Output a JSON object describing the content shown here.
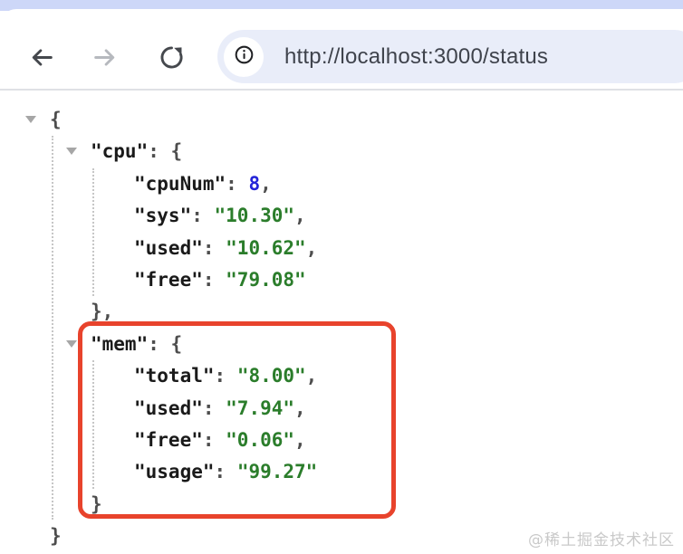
{
  "browser": {
    "url": "http://localhost:3000/status",
    "icons": {
      "back": "arrow-left-icon",
      "forward": "arrow-right-icon",
      "reload": "reload-icon",
      "site_info": "info-icon"
    }
  },
  "json_viewer": {
    "lines": [
      {
        "indent": 0,
        "toggle": true,
        "segments": [
          {
            "t": "{",
            "y": "punct"
          }
        ]
      },
      {
        "indent": 1,
        "toggle": true,
        "segments": [
          {
            "t": "\"cpu\"",
            "y": "key"
          },
          {
            "t": ": {",
            "y": "punct"
          }
        ]
      },
      {
        "indent": 2,
        "toggle": false,
        "segments": [
          {
            "t": "\"cpuNum\"",
            "y": "key"
          },
          {
            "t": ": ",
            "y": "punct"
          },
          {
            "t": "8",
            "y": "num"
          },
          {
            "t": ",",
            "y": "punct"
          }
        ]
      },
      {
        "indent": 2,
        "toggle": false,
        "segments": [
          {
            "t": "\"sys\"",
            "y": "key"
          },
          {
            "t": ": ",
            "y": "punct"
          },
          {
            "t": "\"10.30\"",
            "y": "str"
          },
          {
            "t": ",",
            "y": "punct"
          }
        ]
      },
      {
        "indent": 2,
        "toggle": false,
        "segments": [
          {
            "t": "\"used\"",
            "y": "key"
          },
          {
            "t": ": ",
            "y": "punct"
          },
          {
            "t": "\"10.62\"",
            "y": "str"
          },
          {
            "t": ",",
            "y": "punct"
          }
        ]
      },
      {
        "indent": 2,
        "toggle": false,
        "segments": [
          {
            "t": "\"free\"",
            "y": "key"
          },
          {
            "t": ": ",
            "y": "punct"
          },
          {
            "t": "\"79.08\"",
            "y": "str"
          }
        ]
      },
      {
        "indent": 1,
        "toggle": false,
        "segments": [
          {
            "t": "},",
            "y": "punct"
          }
        ]
      },
      {
        "indent": 1,
        "toggle": true,
        "segments": [
          {
            "t": "\"mem\"",
            "y": "key"
          },
          {
            "t": ": {",
            "y": "punct"
          }
        ]
      },
      {
        "indent": 2,
        "toggle": false,
        "segments": [
          {
            "t": "\"total\"",
            "y": "key"
          },
          {
            "t": ": ",
            "y": "punct"
          },
          {
            "t": "\"8.00\"",
            "y": "str"
          },
          {
            "t": ",",
            "y": "punct"
          }
        ]
      },
      {
        "indent": 2,
        "toggle": false,
        "segments": [
          {
            "t": "\"used\"",
            "y": "key"
          },
          {
            "t": ": ",
            "y": "punct"
          },
          {
            "t": "\"7.94\"",
            "y": "str"
          },
          {
            "t": ",",
            "y": "punct"
          }
        ]
      },
      {
        "indent": 2,
        "toggle": false,
        "segments": [
          {
            "t": "\"free\"",
            "y": "key"
          },
          {
            "t": ": ",
            "y": "punct"
          },
          {
            "t": "\"0.06\"",
            "y": "str"
          },
          {
            "t": ",",
            "y": "punct"
          }
        ]
      },
      {
        "indent": 2,
        "toggle": false,
        "segments": [
          {
            "t": "\"usage\"",
            "y": "key"
          },
          {
            "t": ": ",
            "y": "punct"
          },
          {
            "t": "\"99.27\"",
            "y": "str"
          }
        ]
      },
      {
        "indent": 1,
        "toggle": false,
        "segments": [
          {
            "t": "}",
            "y": "punct"
          }
        ]
      },
      {
        "indent": 0,
        "toggle": false,
        "segments": [
          {
            "t": "}",
            "y": "punct"
          }
        ]
      }
    ]
  },
  "watermark": "@稀土掘金技术社区",
  "colors": {
    "highlight_red": "#e8432c",
    "json_string_green": "#2b7d2b",
    "json_number_blue": "#2424d8",
    "tab_strip": "#cdd7f8",
    "address_pill": "#e9edf9"
  }
}
